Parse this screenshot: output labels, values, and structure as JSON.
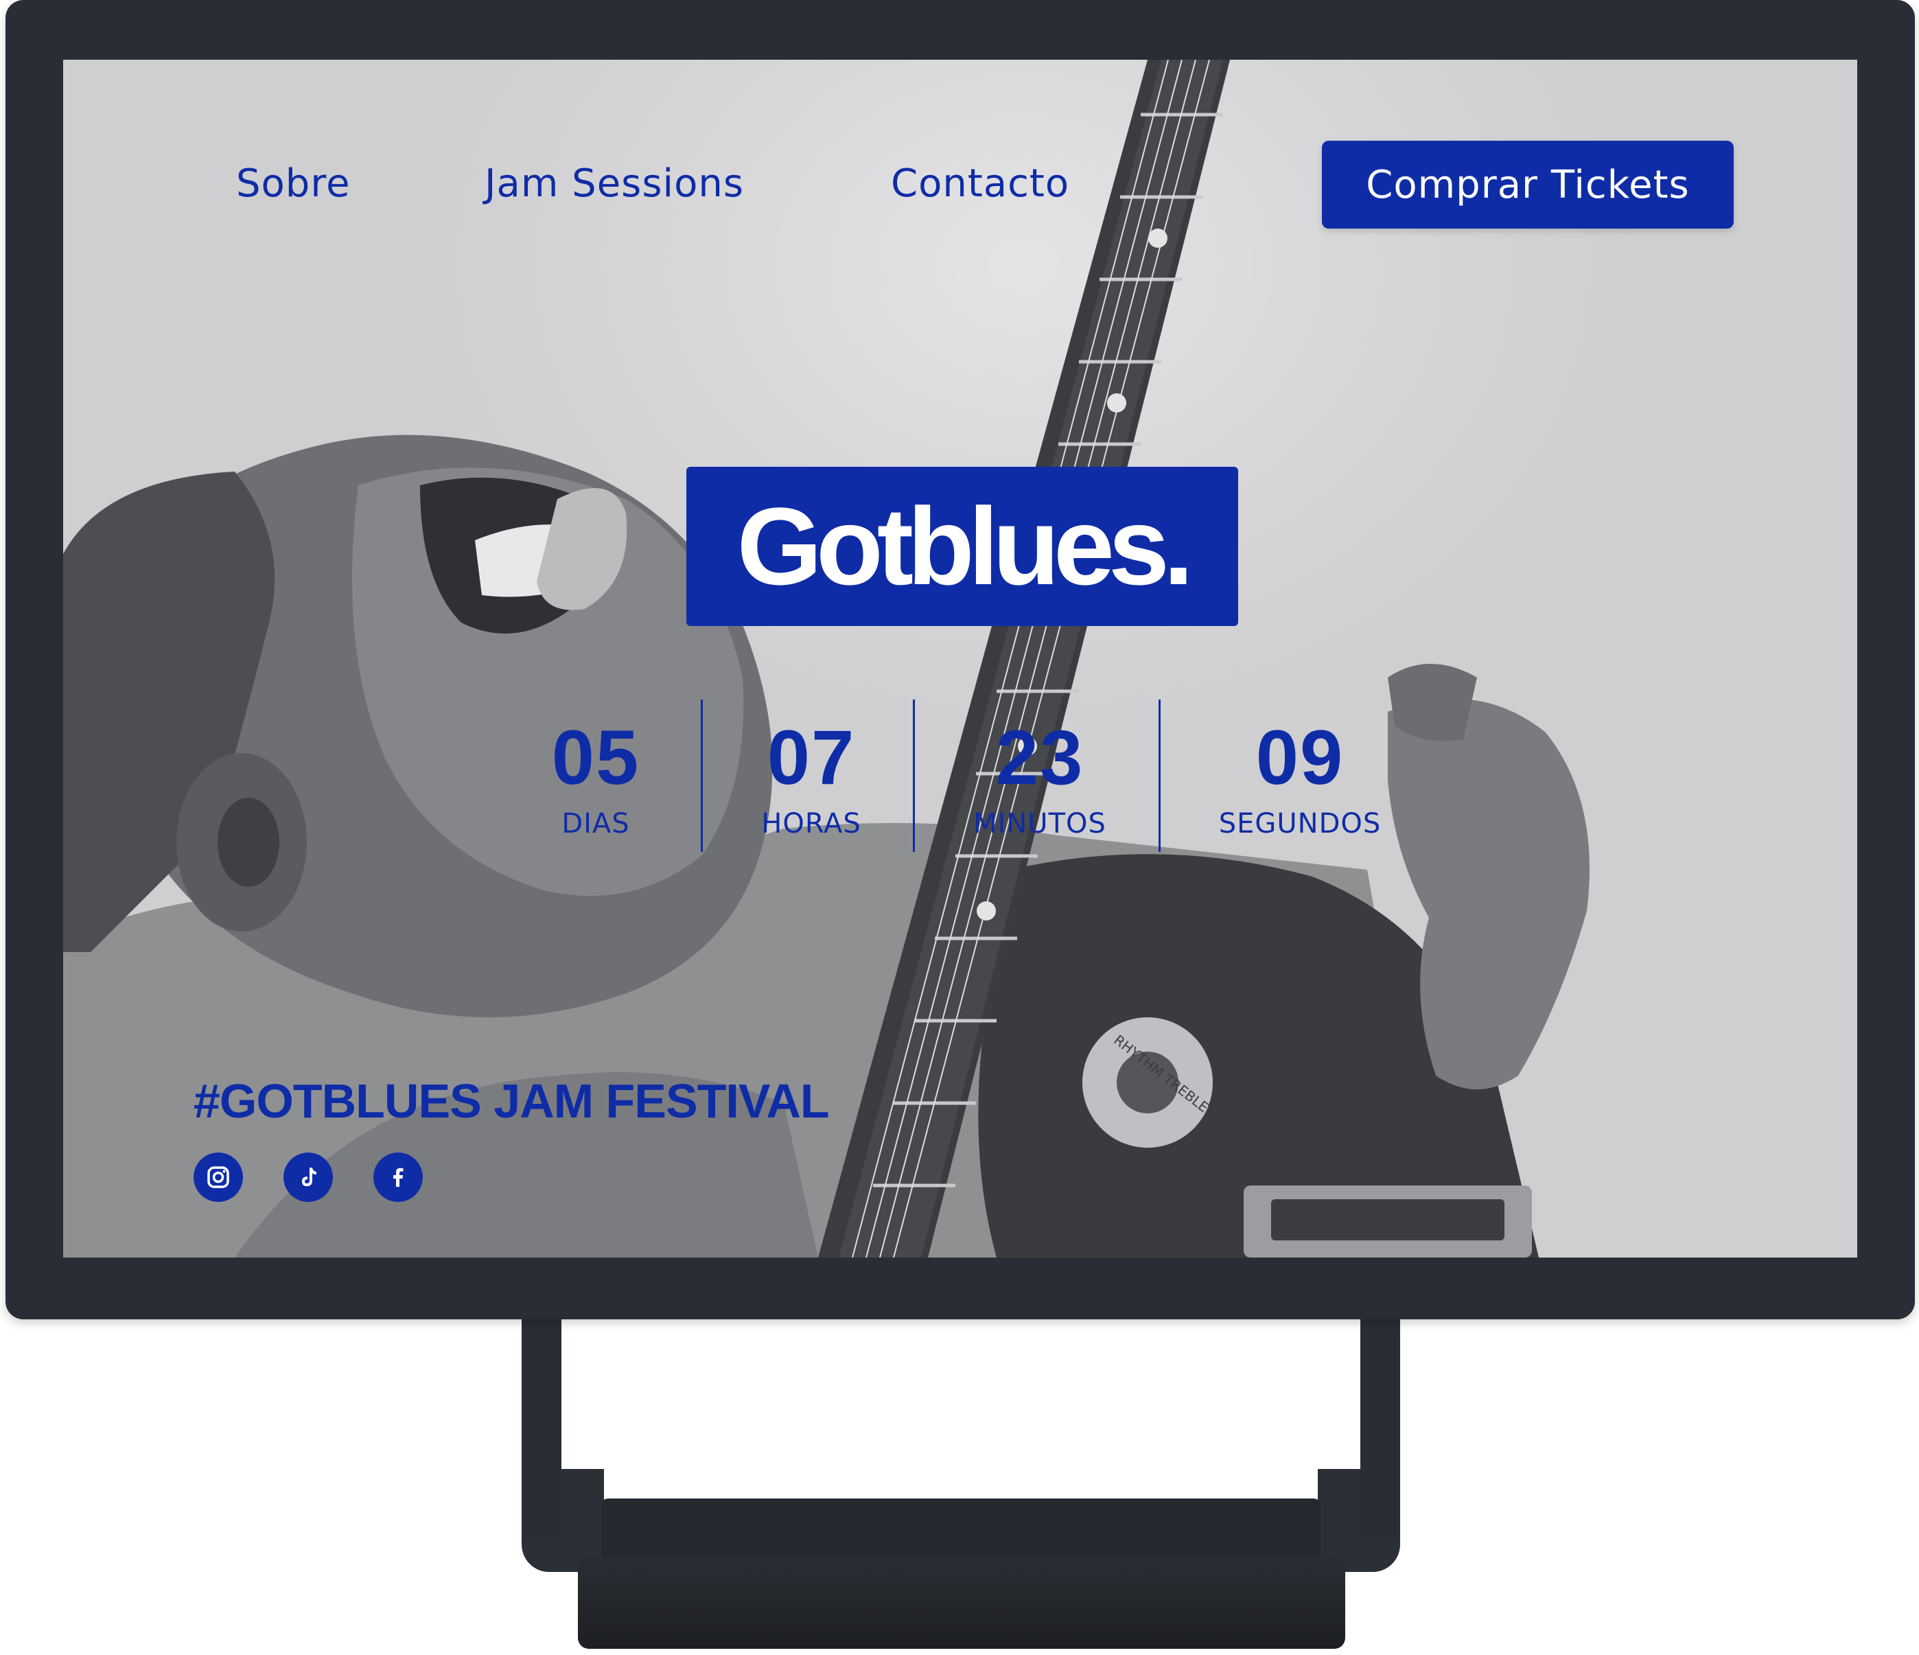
{
  "nav": {
    "links": [
      "Sobre",
      "Jam Sessions",
      "Contacto"
    ],
    "cta_label": "Comprar Tickets"
  },
  "hero": {
    "logo": "Gotblues.",
    "countdown": [
      {
        "value": "05",
        "label": "DIAS"
      },
      {
        "value": "07",
        "label": "HORAS"
      },
      {
        "value": "23",
        "label": "MINUTOS"
      },
      {
        "value": "09",
        "label": "SEGUNDOS"
      }
    ],
    "photo_label": "RHYTHM TREBLE"
  },
  "footer": {
    "tagline": "#GOTBLUES JAM FESTIVAL",
    "socials": [
      "instagram-icon",
      "tiktok-icon",
      "facebook-icon"
    ]
  },
  "colors": {
    "brand_blue": "#0f2ca7",
    "monitor_frame": "#292d35",
    "photo_bg": "#dcdcdc"
  }
}
